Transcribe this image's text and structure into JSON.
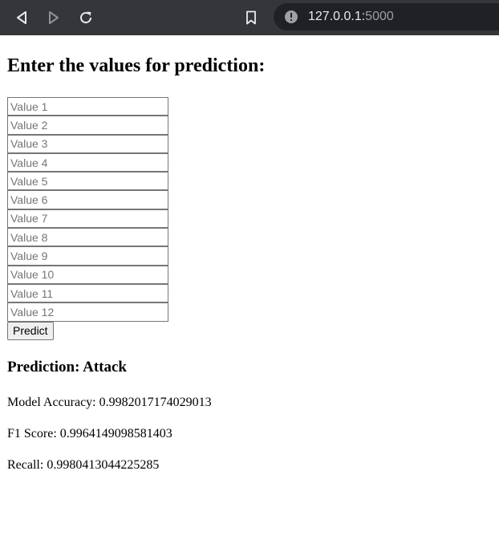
{
  "browser": {
    "url_host": "127.0.0.1:",
    "url_port": "5000",
    "icons": {
      "back": "back-arrow-icon",
      "forward": "forward-arrow-icon",
      "reload": "reload-icon",
      "bookmark": "bookmark-icon",
      "site_info": "site-info-icon"
    }
  },
  "page": {
    "title": "Enter the values for prediction:",
    "inputs": [
      {
        "placeholder": "Value 1",
        "value": ""
      },
      {
        "placeholder": "Value 2",
        "value": ""
      },
      {
        "placeholder": "Value 3",
        "value": ""
      },
      {
        "placeholder": "Value 4",
        "value": ""
      },
      {
        "placeholder": "Value 5",
        "value": ""
      },
      {
        "placeholder": "Value 6",
        "value": ""
      },
      {
        "placeholder": "Value 7",
        "value": ""
      },
      {
        "placeholder": "Value 8",
        "value": ""
      },
      {
        "placeholder": "Value 9",
        "value": ""
      },
      {
        "placeholder": "Value 10",
        "value": ""
      },
      {
        "placeholder": "Value 11",
        "value": ""
      },
      {
        "placeholder": "Value 12",
        "value": ""
      }
    ],
    "predict_label": "Predict",
    "prediction": "Prediction: Attack",
    "accuracy": "Model Accuracy: 0.9982017174029013",
    "f1": "F1 Score: 0.9964149098581403",
    "recall": "Recall: 0.9980413044225285"
  }
}
